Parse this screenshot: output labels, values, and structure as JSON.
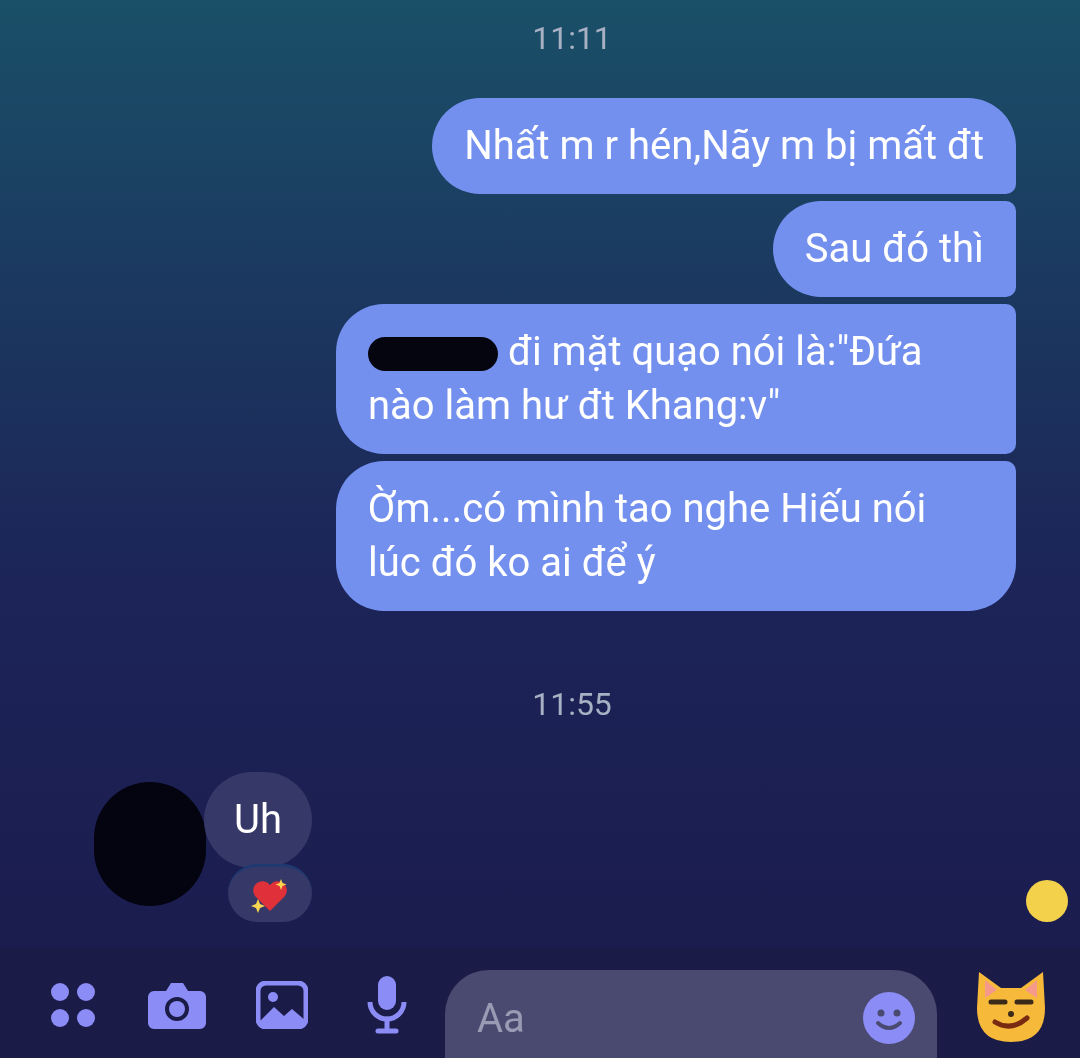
{
  "messages": [
    {
      "kind": "time",
      "text": "11:11"
    },
    {
      "kind": "out",
      "text": "Nhất m r hén,Nãy m bị mất đt",
      "redacted_start": false
    },
    {
      "kind": "out",
      "text": "Sau đó thì",
      "redacted_start": false
    },
    {
      "kind": "out",
      "text": "đi mặt quạo nói là:\"Đứa nào làm hư đt Khang:v\"",
      "redacted_start": true
    },
    {
      "kind": "out",
      "text": "Ờm...có mình tao nghe Hiếu nói lúc đó ko ai để ý",
      "redacted_start": false
    },
    {
      "kind": "time",
      "text": "11:55"
    },
    {
      "kind": "in",
      "text": "Uh",
      "reaction": true
    }
  ],
  "composer": {
    "placeholder": "Aa"
  }
}
